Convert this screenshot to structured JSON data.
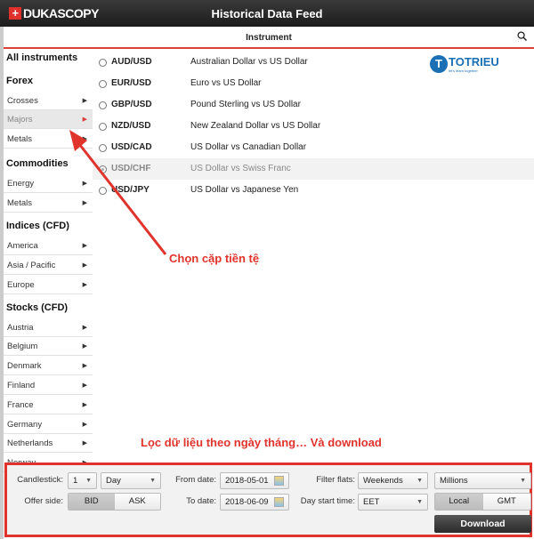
{
  "header": {
    "logo": "DUKASCOPY",
    "title": "Historical Data Feed"
  },
  "instrument_bar": {
    "label": "Instrument"
  },
  "sidebar": {
    "all": "All instruments",
    "groups": [
      {
        "title": "Forex",
        "items": [
          "Crosses",
          "Majors",
          "Metals"
        ]
      },
      {
        "title": "Commodities",
        "items": [
          "Energy",
          "Metals"
        ]
      },
      {
        "title": "Indices (CFD)",
        "items": [
          "America",
          "Asia / Pacific",
          "Europe"
        ]
      },
      {
        "title": "Stocks (CFD)",
        "items": [
          "Austria",
          "Belgium",
          "Denmark",
          "Finland",
          "France",
          "Germany",
          "Netherlands",
          "Norway"
        ]
      }
    ],
    "selected": "Majors"
  },
  "instruments": [
    {
      "code": "AUD/USD",
      "desc": "Australian Dollar vs US Dollar"
    },
    {
      "code": "EUR/USD",
      "desc": "Euro vs US Dollar"
    },
    {
      "code": "GBP/USD",
      "desc": "Pound Sterling vs US Dollar"
    },
    {
      "code": "NZD/USD",
      "desc": "New Zealand Dollar vs US Dollar"
    },
    {
      "code": "USD/CAD",
      "desc": "US Dollar vs Canadian Dollar"
    },
    {
      "code": "USD/CHF",
      "desc": "US Dollar vs Swiss Franc",
      "selected": true
    },
    {
      "code": "USD/JPY",
      "desc": "US Dollar vs Japanese Yen"
    }
  ],
  "watermark": {
    "name": "TOTRIEU",
    "tagline": "let's learn together"
  },
  "annotations": {
    "pair": "Chọn cặp tiền tệ",
    "filter": "Lọc dữ liệu theo ngày tháng… Và download",
    "color": "#e0332c"
  },
  "panel": {
    "candlestick_label": "Candlestick:",
    "candlestick_count": "1",
    "candlestick_period": "Day",
    "from_label": "From date:",
    "from_date": "2018-05-01",
    "to_label": "To date:",
    "to_date": "2018-06-09",
    "filter_label": "Filter flats:",
    "filter_value": "Weekends",
    "volume_unit": "Millions",
    "offer_label": "Offer side:",
    "offer_options": [
      "BID",
      "ASK"
    ],
    "offer_selected": "BID",
    "day_start_label": "Day start time:",
    "day_start_value": "EET",
    "tz_options": [
      "Local",
      "GMT"
    ],
    "tz_selected": "Local",
    "download": "Download"
  }
}
